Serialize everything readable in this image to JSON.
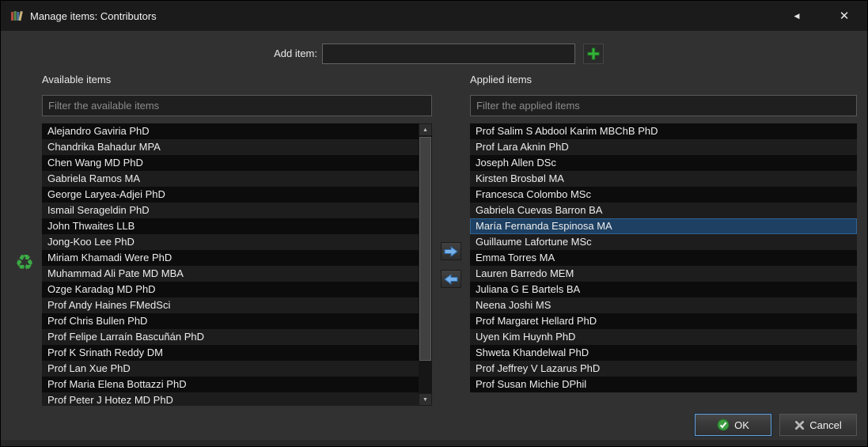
{
  "window": {
    "title": "Manage items: Contributors"
  },
  "titlebar": {
    "back_glyph": "◀",
    "close_glyph": "✕"
  },
  "add_item": {
    "label": "Add item:",
    "value": ""
  },
  "available": {
    "header": "Available items",
    "filter_placeholder": "Filter the available items",
    "filter_value": "",
    "items": [
      "Alejandro Gaviria PhD",
      "Chandrika Bahadur MPA",
      "Chen Wang MD PhD",
      "Gabriela Ramos MA",
      "George Laryea-Adjei PhD",
      "Ismail Serageldin PhD",
      "John Thwaites LLB",
      "Jong-Koo Lee PhD",
      "Miriam Khamadi Were PhD",
      "Muhammad Ali Pate MD MBA",
      "Ozge Karadag MD PhD",
      "Prof Andy Haines FMedSci",
      "Prof Chris Bullen PhD",
      "Prof Felipe Larraín Bascuñán PhD",
      "Prof K Srinath Reddy DM",
      "Prof Lan Xue PhD",
      "Prof Maria Elena Bottazzi PhD",
      "Prof Peter J Hotez MD PhD"
    ]
  },
  "applied": {
    "header": "Applied items",
    "filter_placeholder": "Filter the applied items",
    "filter_value": "",
    "selected_index": 6,
    "items": [
      "Prof Salim S Abdool Karim MBChB PhD",
      "Prof Lara Aknin PhD",
      "Joseph Allen DSc",
      "Kirsten Brosbøl MA",
      "Francesca Colombo MSc",
      "Gabriela Cuevas Barron BA",
      "María Fernanda Espinosa MA",
      "Guillaume Lafortune MSc",
      "Emma Torres MA",
      "Lauren Barredo MEM",
      "Juliana G E Bartels BA",
      "Neena Joshi MS",
      "Prof Margaret Hellard PhD",
      "Uyen Kim Huynh PhD",
      "Shweta Khandelwal PhD",
      "Prof Jeffrey V Lazarus PhD",
      "Prof Susan Michie DPhil"
    ]
  },
  "scrollbar": {
    "up_glyph": "▲",
    "down_glyph": "▼"
  },
  "icons": {
    "app": "books-icon",
    "add": "green-plus-icon",
    "move_right": "blue-arrow-right-icon",
    "move_left": "blue-arrow-left-icon",
    "recycle_glyph": "♻",
    "ok": "green-check-circle-icon",
    "cancel": "gray-x-icon"
  },
  "footer": {
    "ok_label": "OK",
    "cancel_label": "Cancel"
  },
  "colors": {
    "selection_blue": "#1d4063",
    "accent_green": "#3cab45",
    "arrow_blue": "#76b0ea",
    "titlebar": "#1b1b1b",
    "dialog_bg": "#313131"
  }
}
